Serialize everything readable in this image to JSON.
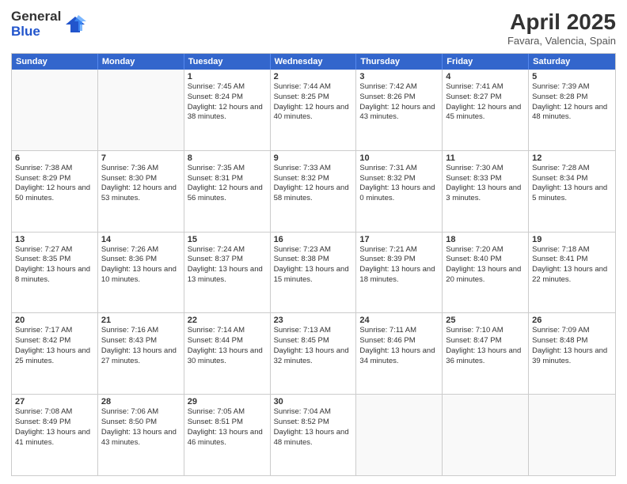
{
  "logo": {
    "general": "General",
    "blue": "Blue"
  },
  "title": "April 2025",
  "subtitle": "Favara, Valencia, Spain",
  "header_days": [
    "Sunday",
    "Monday",
    "Tuesday",
    "Wednesday",
    "Thursday",
    "Friday",
    "Saturday"
  ],
  "rows": [
    [
      {
        "day": "",
        "info": ""
      },
      {
        "day": "",
        "info": ""
      },
      {
        "day": "1",
        "info": "Sunrise: 7:45 AM\nSunset: 8:24 PM\nDaylight: 12 hours and 38 minutes."
      },
      {
        "day": "2",
        "info": "Sunrise: 7:44 AM\nSunset: 8:25 PM\nDaylight: 12 hours and 40 minutes."
      },
      {
        "day": "3",
        "info": "Sunrise: 7:42 AM\nSunset: 8:26 PM\nDaylight: 12 hours and 43 minutes."
      },
      {
        "day": "4",
        "info": "Sunrise: 7:41 AM\nSunset: 8:27 PM\nDaylight: 12 hours and 45 minutes."
      },
      {
        "day": "5",
        "info": "Sunrise: 7:39 AM\nSunset: 8:28 PM\nDaylight: 12 hours and 48 minutes."
      }
    ],
    [
      {
        "day": "6",
        "info": "Sunrise: 7:38 AM\nSunset: 8:29 PM\nDaylight: 12 hours and 50 minutes."
      },
      {
        "day": "7",
        "info": "Sunrise: 7:36 AM\nSunset: 8:30 PM\nDaylight: 12 hours and 53 minutes."
      },
      {
        "day": "8",
        "info": "Sunrise: 7:35 AM\nSunset: 8:31 PM\nDaylight: 12 hours and 56 minutes."
      },
      {
        "day": "9",
        "info": "Sunrise: 7:33 AM\nSunset: 8:32 PM\nDaylight: 12 hours and 58 minutes."
      },
      {
        "day": "10",
        "info": "Sunrise: 7:31 AM\nSunset: 8:32 PM\nDaylight: 13 hours and 0 minutes."
      },
      {
        "day": "11",
        "info": "Sunrise: 7:30 AM\nSunset: 8:33 PM\nDaylight: 13 hours and 3 minutes."
      },
      {
        "day": "12",
        "info": "Sunrise: 7:28 AM\nSunset: 8:34 PM\nDaylight: 13 hours and 5 minutes."
      }
    ],
    [
      {
        "day": "13",
        "info": "Sunrise: 7:27 AM\nSunset: 8:35 PM\nDaylight: 13 hours and 8 minutes."
      },
      {
        "day": "14",
        "info": "Sunrise: 7:26 AM\nSunset: 8:36 PM\nDaylight: 13 hours and 10 minutes."
      },
      {
        "day": "15",
        "info": "Sunrise: 7:24 AM\nSunset: 8:37 PM\nDaylight: 13 hours and 13 minutes."
      },
      {
        "day": "16",
        "info": "Sunrise: 7:23 AM\nSunset: 8:38 PM\nDaylight: 13 hours and 15 minutes."
      },
      {
        "day": "17",
        "info": "Sunrise: 7:21 AM\nSunset: 8:39 PM\nDaylight: 13 hours and 18 minutes."
      },
      {
        "day": "18",
        "info": "Sunrise: 7:20 AM\nSunset: 8:40 PM\nDaylight: 13 hours and 20 minutes."
      },
      {
        "day": "19",
        "info": "Sunrise: 7:18 AM\nSunset: 8:41 PM\nDaylight: 13 hours and 22 minutes."
      }
    ],
    [
      {
        "day": "20",
        "info": "Sunrise: 7:17 AM\nSunset: 8:42 PM\nDaylight: 13 hours and 25 minutes."
      },
      {
        "day": "21",
        "info": "Sunrise: 7:16 AM\nSunset: 8:43 PM\nDaylight: 13 hours and 27 minutes."
      },
      {
        "day": "22",
        "info": "Sunrise: 7:14 AM\nSunset: 8:44 PM\nDaylight: 13 hours and 30 minutes."
      },
      {
        "day": "23",
        "info": "Sunrise: 7:13 AM\nSunset: 8:45 PM\nDaylight: 13 hours and 32 minutes."
      },
      {
        "day": "24",
        "info": "Sunrise: 7:11 AM\nSunset: 8:46 PM\nDaylight: 13 hours and 34 minutes."
      },
      {
        "day": "25",
        "info": "Sunrise: 7:10 AM\nSunset: 8:47 PM\nDaylight: 13 hours and 36 minutes."
      },
      {
        "day": "26",
        "info": "Sunrise: 7:09 AM\nSunset: 8:48 PM\nDaylight: 13 hours and 39 minutes."
      }
    ],
    [
      {
        "day": "27",
        "info": "Sunrise: 7:08 AM\nSunset: 8:49 PM\nDaylight: 13 hours and 41 minutes."
      },
      {
        "day": "28",
        "info": "Sunrise: 7:06 AM\nSunset: 8:50 PM\nDaylight: 13 hours and 43 minutes."
      },
      {
        "day": "29",
        "info": "Sunrise: 7:05 AM\nSunset: 8:51 PM\nDaylight: 13 hours and 46 minutes."
      },
      {
        "day": "30",
        "info": "Sunrise: 7:04 AM\nSunset: 8:52 PM\nDaylight: 13 hours and 48 minutes."
      },
      {
        "day": "",
        "info": ""
      },
      {
        "day": "",
        "info": ""
      },
      {
        "day": "",
        "info": ""
      }
    ]
  ]
}
